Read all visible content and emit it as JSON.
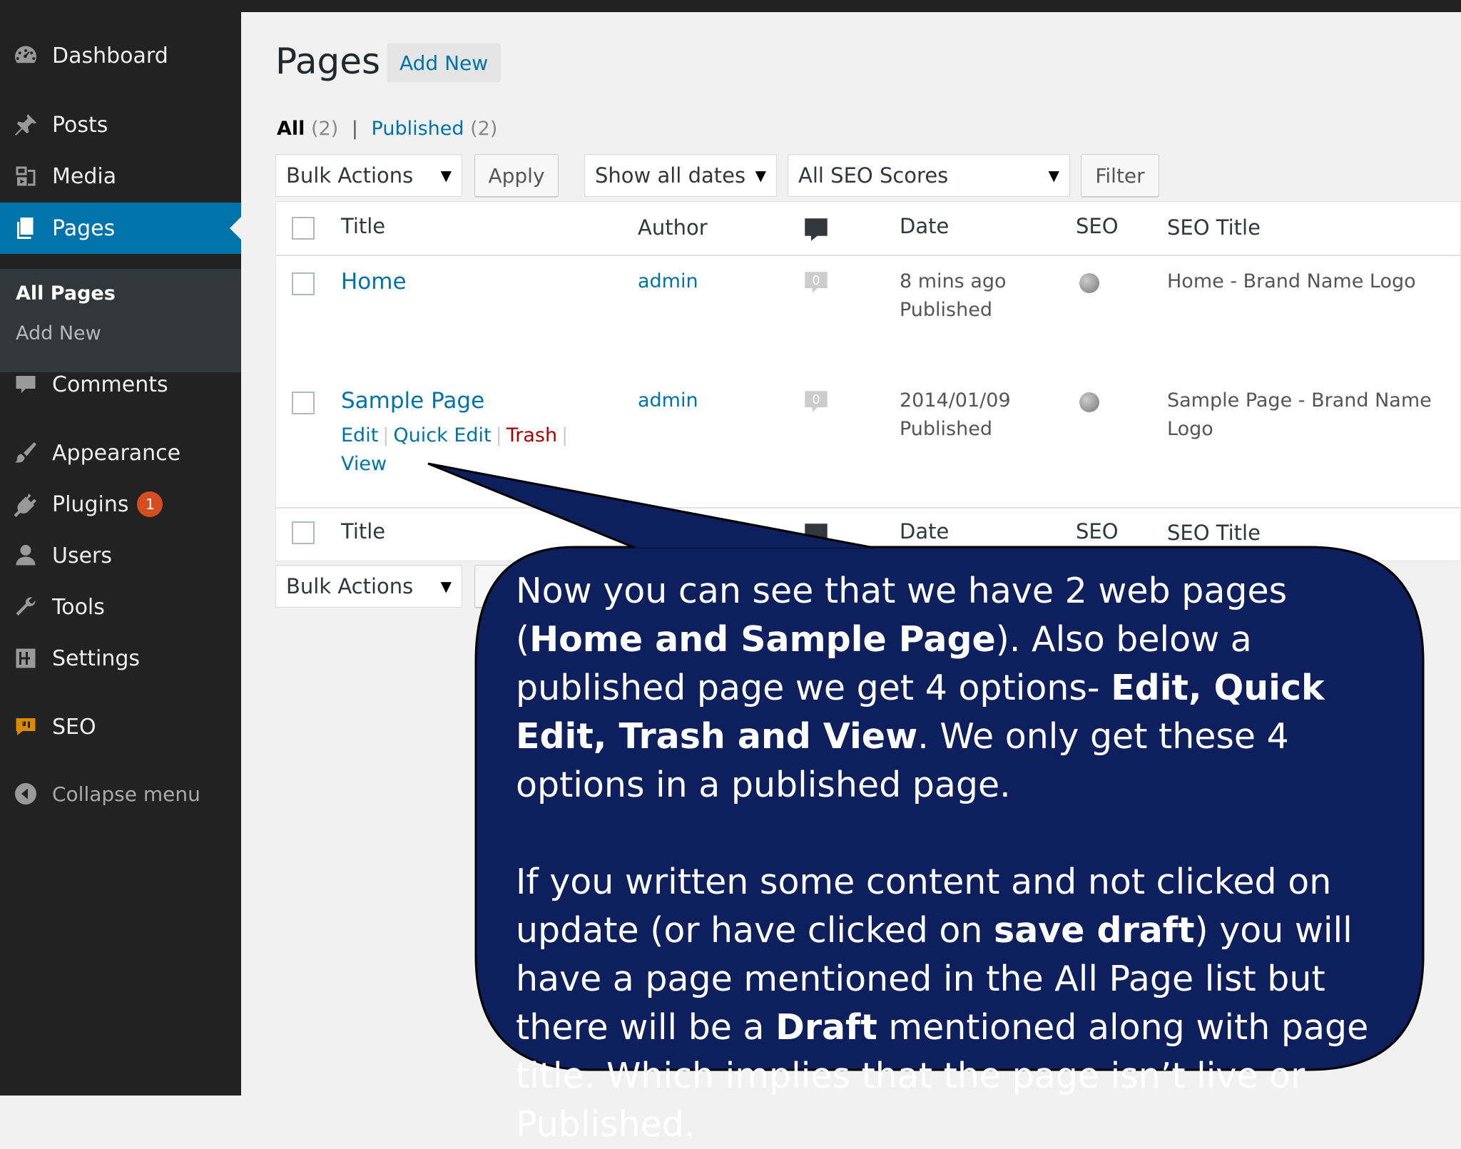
{
  "sidebar": {
    "items": [
      {
        "label": "Dashboard",
        "icon": "dashboard-icon"
      },
      {
        "label": "Posts",
        "icon": "pin-icon"
      },
      {
        "label": "Media",
        "icon": "media-icon"
      },
      {
        "label": "Pages",
        "icon": "pages-icon"
      },
      {
        "label": "Comments",
        "icon": "comment-icon"
      },
      {
        "label": "Appearance",
        "icon": "brush-icon"
      },
      {
        "label": "Plugins",
        "icon": "plug-icon",
        "badge": "1"
      },
      {
        "label": "Users",
        "icon": "user-icon"
      },
      {
        "label": "Tools",
        "icon": "wrench-icon"
      },
      {
        "label": "Settings",
        "icon": "settings-icon"
      },
      {
        "label": "SEO",
        "icon": "seo-icon"
      },
      {
        "label": "Collapse menu",
        "icon": "collapse-icon"
      }
    ],
    "submenu": [
      "All Pages",
      "Add New"
    ]
  },
  "header": {
    "title": "Pages",
    "add_new": "Add New"
  },
  "filters": {
    "all_label": "All",
    "all_count": "(2)",
    "sep": "|",
    "published_label": "Published",
    "published_count": "(2)",
    "bulk_actions": "Bulk Actions",
    "apply": "Apply",
    "dates": "Show all dates",
    "seo_scores": "All SEO Scores",
    "filter": "Filter"
  },
  "table": {
    "columns": {
      "title": "Title",
      "author": "Author",
      "date": "Date",
      "seo": "SEO",
      "seo_title": "SEO Title"
    },
    "rows": [
      {
        "title": "Home",
        "author": "admin",
        "comments": "0",
        "date1": "8 mins ago",
        "date2": "Published",
        "seo_title": "Home - Brand Name Logo"
      },
      {
        "title": "Sample Page",
        "author": "admin",
        "comments": "0",
        "date1": "2014/01/09",
        "date2": "Published",
        "seo_title": "Sample Page - Brand Name Logo"
      }
    ],
    "row_actions": {
      "edit": "Edit",
      "quick_edit": "Quick Edit",
      "trash": "Trash",
      "view": "View",
      "sep": "|"
    }
  },
  "bottom": {
    "bulk_actions": "Bulk Actions"
  },
  "callout": {
    "p1": [
      {
        "t": "Now you can see that we have 2 web pages (",
        "b": false
      },
      {
        "t": "Home and Sample Page",
        "b": true
      },
      {
        "t": "). Also below a published page we get 4 options- ",
        "b": false
      },
      {
        "t": "Edit, Quick Edit, Trash and View",
        "b": true
      },
      {
        "t": ". We only get these 4 options in a published page.",
        "b": false
      }
    ],
    "p2": [
      {
        "t": "If you written some content and not clicked on update (or have clicked on ",
        "b": false
      },
      {
        "t": "save draft",
        "b": true
      },
      {
        "t": ") you will have a page mentioned in the All Page list but there will be a ",
        "b": false
      },
      {
        "t": "Draft",
        "b": true
      },
      {
        "t": " mentioned along with page title. Which implies that the page isn’t live or Published.",
        "b": false
      }
    ]
  },
  "colors": {
    "sidebar": "#222222",
    "active": "#0073aa",
    "callout_fill": "#0d1f5c",
    "link": "#0073aa",
    "trash": "#aa0000"
  }
}
